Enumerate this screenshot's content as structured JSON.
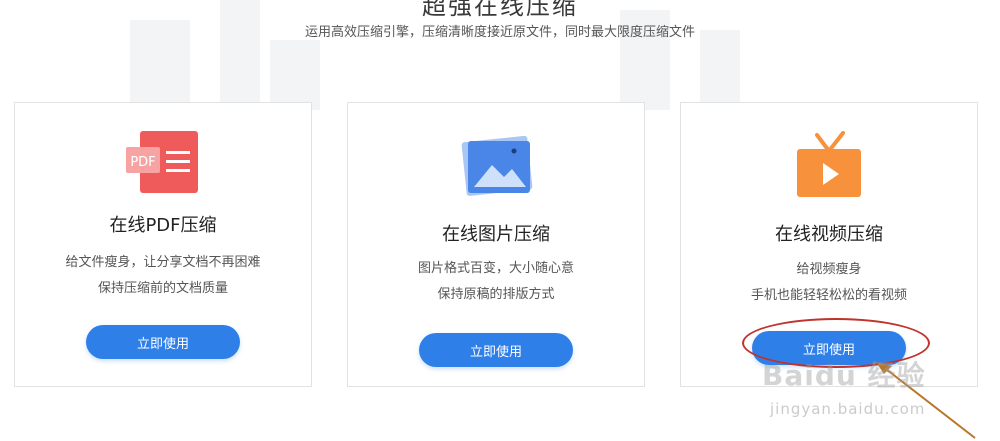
{
  "header": {
    "title": "超强在线压缩",
    "subtitle": "运用高效压缩引擎，压缩清晰度接近原文件，同时最大限度压缩文件"
  },
  "cards": [
    {
      "title": "在线PDF压缩",
      "desc_line1": "给文件瘦身，让分享文档不再困难",
      "desc_line2": "保持压缩前的文档质量",
      "button": "立即使用",
      "icon": "pdf-icon",
      "icon_text": "PDF"
    },
    {
      "title": "在线图片压缩",
      "desc_line1": "图片格式百变，大小随心意",
      "desc_line2": "保持原稿的排版方式",
      "button": "立即使用",
      "icon": "image-icon"
    },
    {
      "title": "在线视频压缩",
      "desc_line1": "给视频瘦身",
      "desc_line2": "手机也能轻轻松松的看视频",
      "button": "立即使用",
      "icon": "video-tv-icon"
    }
  ],
  "watermark": {
    "brand": "Baidu 经验",
    "url": "jingyan.baidu.com"
  },
  "colors": {
    "button": "#2f7fe8",
    "pdf_icon": "#ef5b5b",
    "image_icon": "#4a86e8",
    "video_icon": "#f7913b",
    "annotation": "#c0322b"
  }
}
